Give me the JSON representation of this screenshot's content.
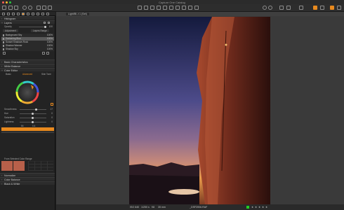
{
  "app": {
    "title": "Capture One Catalog"
  },
  "viewer": {
    "tab_label": "Light/Bl..t 1 (Set)"
  },
  "panel": {
    "layers_header": "Layers",
    "opacity_label": "Opacity",
    "opacity_value": "100",
    "layer_dropdown": "Adjustment",
    "layer_dropdown2": "Layers Range",
    "layers": [
      {
        "label": "Background Sky",
        "value": "100%"
      },
      {
        "label": "Darkening Blue",
        "value": "100%"
      },
      {
        "label": "Sunset Shadows Rock",
        "value": "100%"
      },
      {
        "label": "Shadow Warmer",
        "value": "100%"
      },
      {
        "label": "Shadow Sky",
        "value": "100%"
      }
    ],
    "sections": {
      "histogram": "Histogram",
      "basic": "Basic Characteristics",
      "white_balance": "White Balance",
      "color_editor": "Color Editor",
      "normalize": "Normalize",
      "color_balance": "Color Balance",
      "bw": "Black & White"
    },
    "color_editor_tabs": [
      "Basic",
      "Advanced",
      "Skin Tone"
    ],
    "sliders": [
      {
        "label": "Smoothness",
        "value": "17"
      },
      {
        "label": "Hue",
        "value": "0"
      },
      {
        "label": "Saturation",
        "value": "0"
      },
      {
        "label": "Lightness",
        "value": "0"
      }
    ],
    "range_values": [
      "64",
      "0.4"
    ],
    "from_text": "From Selected Color Range"
  },
  "status": {
    "iso": "ISO 640",
    "shutter": "1/250 s",
    "aperture": "f/8",
    "focal": "35 mm",
    "filename": "_DSF3906.RAF"
  },
  "rating": {
    "stars": 0,
    "max": 5,
    "tag_color": "#22cc22"
  }
}
